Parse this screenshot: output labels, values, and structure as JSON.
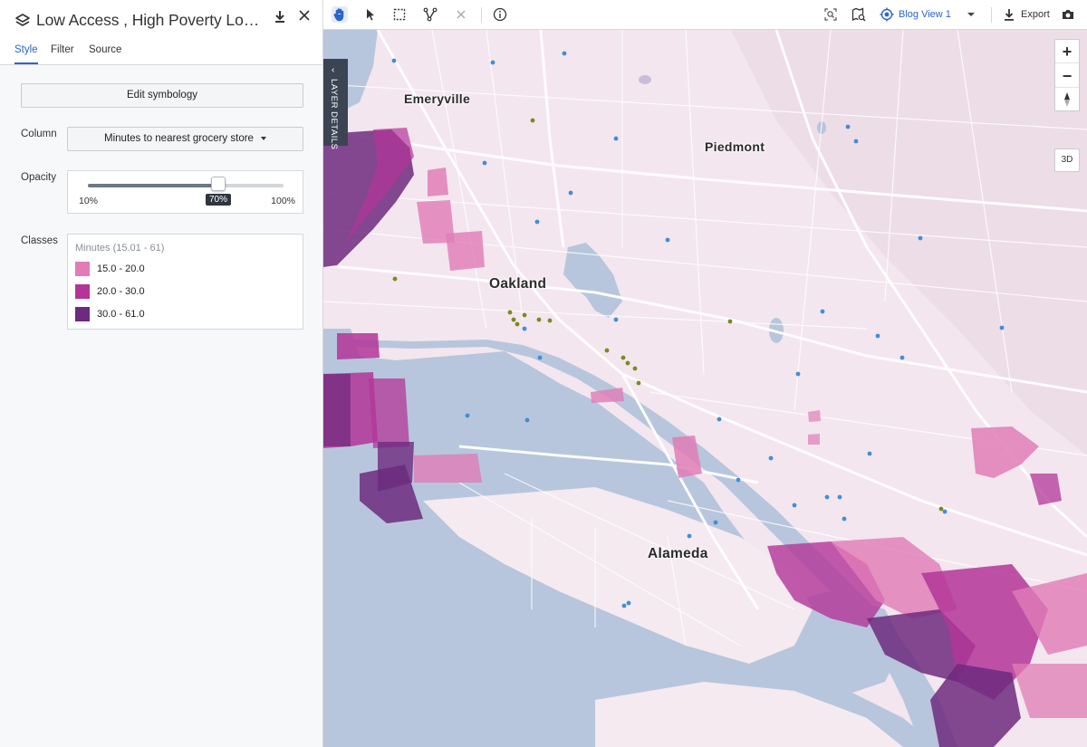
{
  "panel": {
    "title": "Low Access , High Poverty Locati...",
    "tabs": [
      {
        "label": "Style"
      },
      {
        "label": "Filter"
      },
      {
        "label": "Source"
      }
    ],
    "edit_symbology_label": "Edit symbology",
    "column": {
      "label": "Column",
      "selected": "Minutes to nearest grocery store"
    },
    "opacity": {
      "label": "Opacity",
      "value": 0.7,
      "value_label": "70%",
      "min_label": "10%",
      "max_label": "100%"
    },
    "classes": {
      "label": "Classes",
      "title": "Minutes (15.01 - 61)",
      "items": [
        {
          "label": "15.0 - 20.0",
          "color": "#e07cb6"
        },
        {
          "label": "20.0 - 30.0",
          "color": "#b33598"
        },
        {
          "label": "30.0 - 61.0",
          "color": "#6d2a7e"
        }
      ]
    }
  },
  "toolbar": {
    "view_label": "Blog View 1",
    "export_label": "Export"
  },
  "map": {
    "layer_details_label": "LAYER DETAILS",
    "cities": {
      "emeryville": "Emeryville",
      "piedmont": "Piedmont",
      "oakland": "Oakland",
      "alameda": "Alameda"
    },
    "zoom_in_label": "+",
    "zoom_out_label": "−",
    "btn_3d_label": "3D"
  },
  "colors": {
    "accent": "#2b64c9",
    "water": "#b7c6dc",
    "land": "#f3e6ee",
    "point_store": "#3f8fd8",
    "point_other": "#7a8a1e"
  }
}
